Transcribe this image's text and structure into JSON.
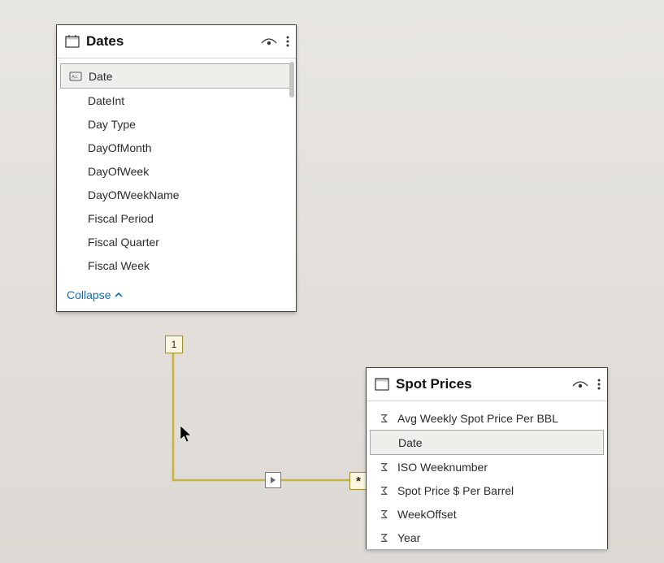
{
  "tables": {
    "dates": {
      "title": "Dates",
      "collapse_label": "Collapse",
      "fields": [
        {
          "label": "Date",
          "icon": "key",
          "selected": true
        },
        {
          "label": "DateInt",
          "icon": "",
          "selected": false
        },
        {
          "label": "Day Type",
          "icon": "",
          "selected": false
        },
        {
          "label": "DayOfMonth",
          "icon": "",
          "selected": false
        },
        {
          "label": "DayOfWeek",
          "icon": "",
          "selected": false
        },
        {
          "label": "DayOfWeekName",
          "icon": "",
          "selected": false
        },
        {
          "label": "Fiscal Period",
          "icon": "",
          "selected": false
        },
        {
          "label": "Fiscal Quarter",
          "icon": "",
          "selected": false
        },
        {
          "label": "Fiscal Week",
          "icon": "",
          "selected": false
        }
      ]
    },
    "spot": {
      "title": "Spot Prices",
      "fields": [
        {
          "label": "Avg Weekly Spot Price Per BBL",
          "icon": "sum",
          "selected": false
        },
        {
          "label": "Date",
          "icon": "",
          "selected": true
        },
        {
          "label": "ISO Weeknumber",
          "icon": "sum",
          "selected": false
        },
        {
          "label": "Spot Price $ Per Barrel",
          "icon": "sum",
          "selected": false
        },
        {
          "label": "WeekOffset",
          "icon": "sum",
          "selected": false
        },
        {
          "label": "Year",
          "icon": "sum",
          "selected": false
        }
      ]
    }
  },
  "relationship": {
    "from_cardinality": "1",
    "to_cardinality": "*"
  }
}
